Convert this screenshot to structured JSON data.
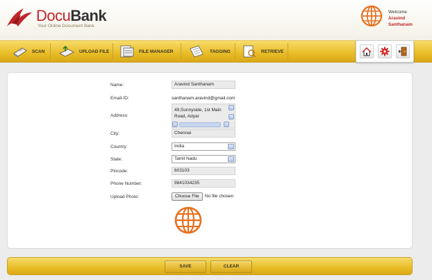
{
  "brand": {
    "name_part1": "Docu",
    "name_part2": "Bank",
    "tagline": "Your Online Document Bank"
  },
  "user": {
    "welcome": "Welcome",
    "first_name": "Aravind",
    "last_name": "Santhanam"
  },
  "nav": {
    "items": [
      {
        "label": "SCAN",
        "icon": "scanner-icon"
      },
      {
        "label": "UPLOAD FILE",
        "icon": "upload-icon"
      },
      {
        "label": "FILE MANAGER",
        "icon": "file-manager-icon"
      },
      {
        "label": "TAGGING",
        "icon": "tagging-icon"
      },
      {
        "label": "RETRIEVE",
        "icon": "retrieve-icon"
      }
    ],
    "tools": [
      "home-icon",
      "settings-gear-icon",
      "logout-door-icon"
    ]
  },
  "form": {
    "name_label": "Name:",
    "name_value": "Aravind Santhanam",
    "email_label": "Email-ID:",
    "email_value": "santhanam.aravind@gmail.com",
    "address_label": "Address:",
    "address_line1": "49,Sunnyside, 1st Main",
    "address_line2": "Road, Adyar",
    "city_label": "City:",
    "city_value": "Chennai",
    "country_label": "Country:",
    "country_value": "India",
    "state_label": "State:",
    "state_value": "Tamil Nadu",
    "pincode_label": "Pincode:",
    "pincode_value": "603103",
    "phone_label": "Phone Number:",
    "phone_value": "9841034235",
    "photo_label": "Upload Photo:",
    "choose_file": "Choose File",
    "no_file": "No file chosen"
  },
  "actions": {
    "save": "SAVE",
    "clear": "CLEAR"
  },
  "colors": {
    "brand_red": "#c0252a",
    "nav_gold": "#e8bc26",
    "globe_orange": "#e8701e"
  }
}
